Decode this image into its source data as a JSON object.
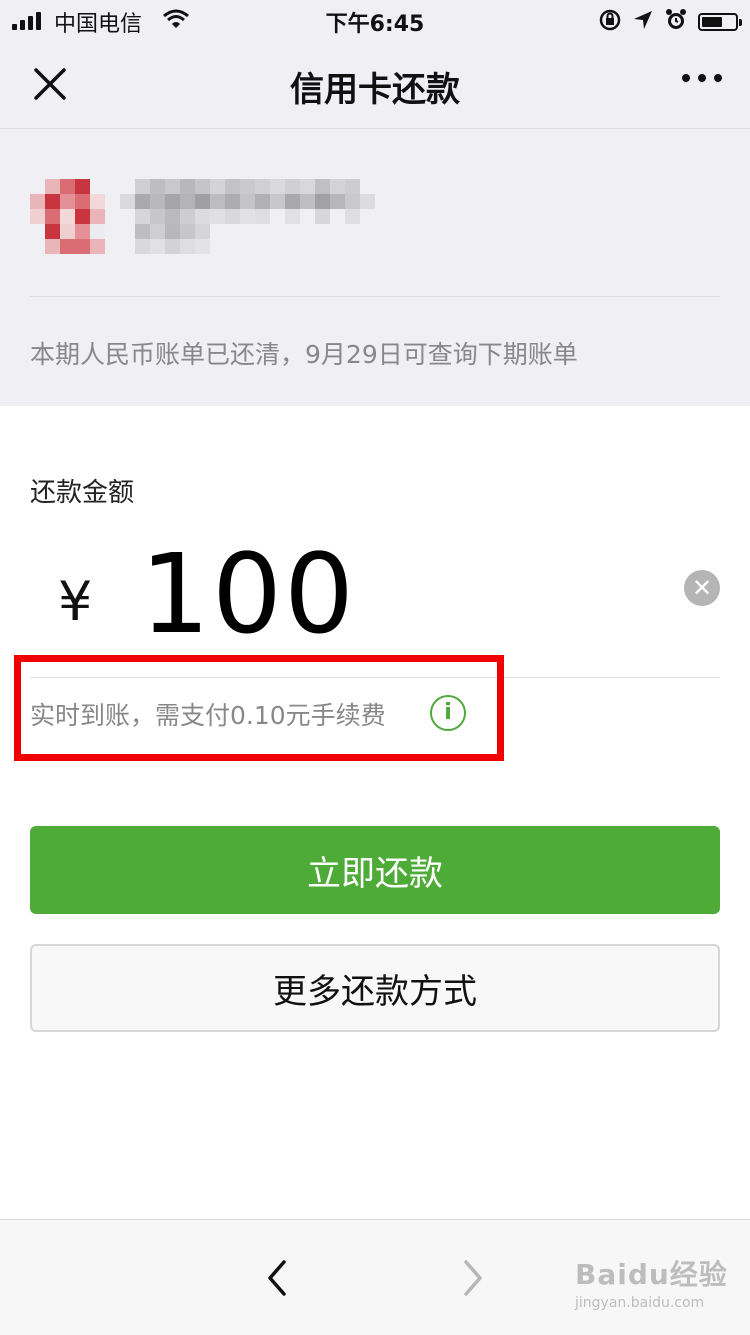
{
  "status_bar": {
    "carrier": "中国电信",
    "time": "下午6:45",
    "battery_level": 0.55
  },
  "nav": {
    "title": "信用卡还款"
  },
  "card": {
    "bill_status": "本期人民币账单已还清，9月29日可查询下期账单"
  },
  "amount": {
    "label": "还款金额",
    "currency": "¥",
    "value": "100"
  },
  "fee": {
    "text": "实时到账，需支付0.10元手续费",
    "info_symbol": "i"
  },
  "buttons": {
    "repay_now": "立即还款",
    "more_methods": "更多还款方式"
  },
  "watermark": {
    "brand": "Baidu经验",
    "url": "jingyan.baidu.com"
  },
  "colors": {
    "accent_green": "#4fab38",
    "highlight_red": "#f00000",
    "bar_bg": "#efeff4"
  }
}
